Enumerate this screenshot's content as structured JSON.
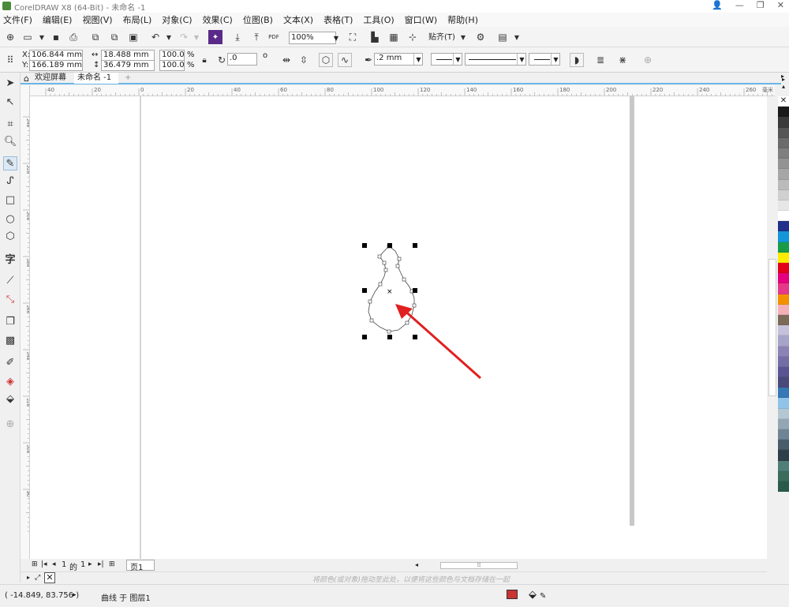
{
  "window": {
    "title": "CorelDRAW X8 (64-Bit) - 未命名 -1",
    "controls": [
      "👤",
      "—",
      "❐",
      "✕"
    ]
  },
  "menu": [
    "文件(F)",
    "编辑(E)",
    "视图(V)",
    "布局(L)",
    "对象(C)",
    "效果(C)",
    "位图(B)",
    "文本(X)",
    "表格(T)",
    "工具(O)",
    "窗口(W)",
    "帮助(H)"
  ],
  "toolbar": {
    "zoom": "100%",
    "snap_label": "贴齐(T)",
    "pdf_label": "PDF"
  },
  "properties": {
    "x_label": "X:",
    "x": "106.844 mm",
    "y_label": "Y:",
    "y": "166.189 mm",
    "width": "18.488 mm",
    "height": "36.479 mm",
    "scale_w": "100.0",
    "scale_h": "100.0",
    "percent": "%",
    "rotation": ".0",
    "rotation_unit": "o",
    "outline_width": ".2 mm"
  },
  "tabs": {
    "welcome": "欢迎屏幕",
    "doc": "未命名 -1",
    "add": "+"
  },
  "rulers": {
    "h_ticks": [
      "40",
      "20",
      "0",
      "20",
      "40",
      "60",
      "80",
      "100",
      "120",
      "140",
      "160",
      "180",
      "200",
      "220",
      "240",
      "260"
    ],
    "h_unit": "毫米",
    "v_ticks": [
      "240",
      "220",
      "200",
      "180",
      "160",
      "140",
      "120",
      "100",
      "80"
    ]
  },
  "pages": {
    "current": "1",
    "of": "的",
    "total": "1",
    "page_tab": "页1"
  },
  "colorbar_hint": "将颜色(或对象)拖动至此处，以便将这些颜色与文档存储在一起",
  "status": {
    "coords": "( -14.849, 83.756 )",
    "arrow": "▸",
    "info": "曲线 于 图层1"
  },
  "palette": [
    "#1a1a1a",
    "#3a3a3a",
    "#555555",
    "#6b6b6b",
    "#7f7f7f",
    "#939393",
    "#a6a6a6",
    "#bbbbbb",
    "#d0d0d0",
    "#e6e6e6",
    "#ffffff",
    "#1f2f8a",
    "#1296d8",
    "#1a9b48",
    "#ffec00",
    "#e3001b",
    "#e5007f",
    "#e63888",
    "#f39200",
    "#f4b0b7",
    "#7b6a58",
    "#c5c0dc",
    "#a8a3c9",
    "#8b82b6",
    "#756da6",
    "#5b5393",
    "#4a4a7a",
    "#3677b5",
    "#8fc3e8",
    "#b5c7d3",
    "#93a6b4",
    "#6f8595",
    "#495c6a",
    "#2e3f4a",
    "#4f7f78",
    "#3b6b5a",
    "#2a5b4a"
  ]
}
